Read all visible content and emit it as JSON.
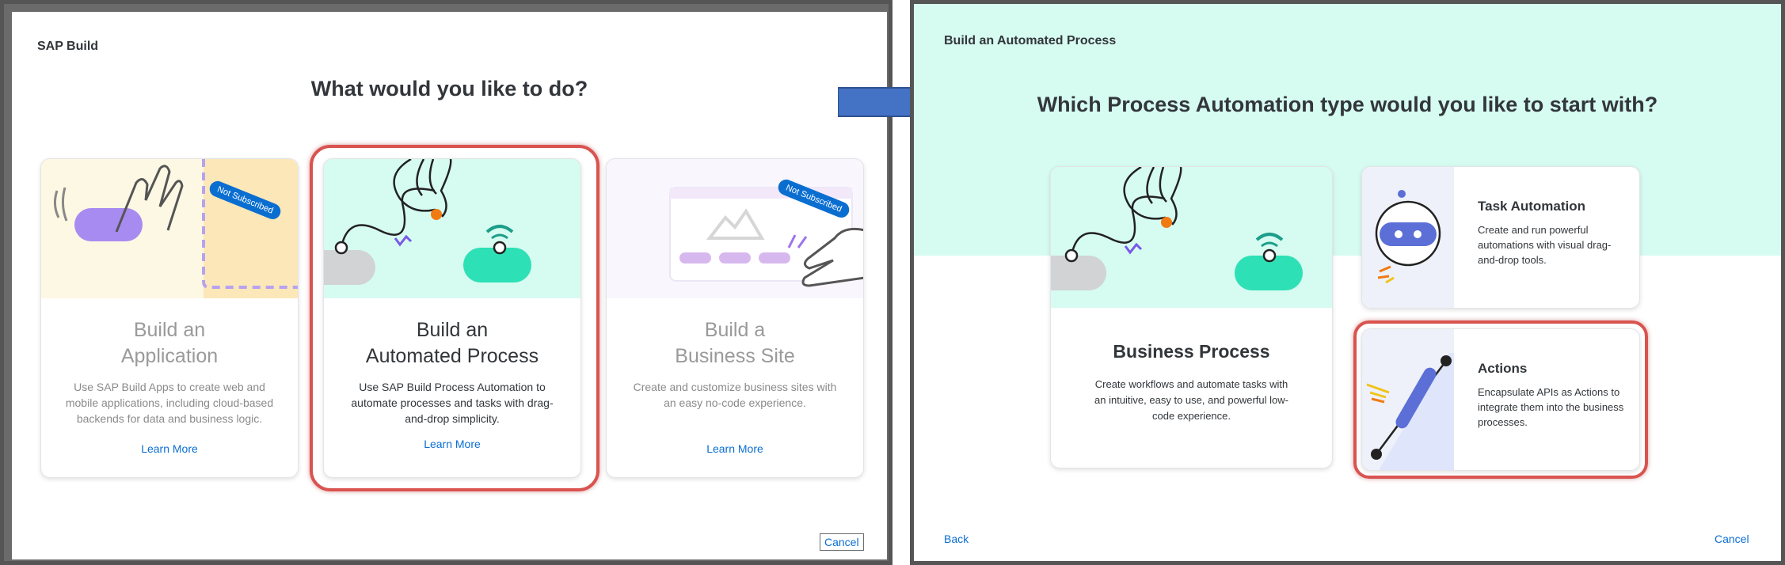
{
  "left_dialog": {
    "title": "SAP Build",
    "heading": "What would you like to do?",
    "cards": [
      {
        "title_line1": "Build an",
        "title_line2": "Application",
        "description": "Use SAP Build Apps to create web and mobile applications, including cloud-based backends for data and business logic.",
        "link": "Learn More",
        "badge": "Not Subscribed"
      },
      {
        "title_line1": "Build an",
        "title_line2": "Automated Process",
        "description": "Use SAP Build Process Automation to automate processes and tasks with drag-and-drop simplicity.",
        "link": "Learn More"
      },
      {
        "title_line1": "Build a",
        "title_line2": "Business Site",
        "description": "Create and customize business sites with an easy no-code experience.",
        "link": "Learn More",
        "badge": "Not Subscribed"
      }
    ],
    "cancel": "Cancel"
  },
  "right_dialog": {
    "title": "Build an Automated Process",
    "heading": "Which Process Automation type would you like to start with?",
    "business_process": {
      "title": "Business Process",
      "description": "Create workflows and automate tasks with an intuitive, easy to use, and powerful low-code experience."
    },
    "task_automation": {
      "title": "Task Automation",
      "description": "Create and run powerful automations with visual drag-and-drop tools."
    },
    "actions": {
      "title": "Actions",
      "description": "Encapsulate APIs as Actions to integrate them into the business processes."
    },
    "back": "Back",
    "cancel": "Cancel"
  },
  "colors": {
    "accent": "#0a6ed1",
    "highlight": "#d9534f",
    "arrow": "#4472c4",
    "mint": "#d6fbf1",
    "teal": "#2ee0b5"
  }
}
